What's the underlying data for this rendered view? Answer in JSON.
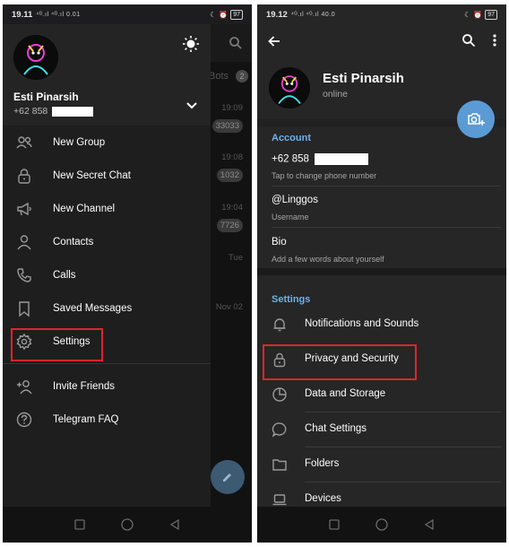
{
  "colors": {
    "accent": "#6fb0ea",
    "fab": "#5b9bd5",
    "highlight": "#e0242d",
    "drawer_bg": "#1e1e1e"
  },
  "left_phone": {
    "status": {
      "time": "19.11",
      "signals": "⁴ᴳ.ıl ⁴ᴳ.ıl 0.01",
      "battery": "97"
    },
    "drawer": {
      "name": "Esti Pinarsih",
      "phone": "+62 858",
      "items": [
        {
          "label": "New Group",
          "icon": "group-icon"
        },
        {
          "label": "New Secret Chat",
          "icon": "lock-icon"
        },
        {
          "label": "New Channel",
          "icon": "megaphone-icon"
        },
        {
          "label": "Contacts",
          "icon": "person-icon"
        },
        {
          "label": "Calls",
          "icon": "phone-icon"
        },
        {
          "label": "Saved Messages",
          "icon": "bookmark-icon"
        },
        {
          "label": "Settings",
          "icon": "gear-icon"
        },
        {
          "label": "Invite Friends",
          "icon": "add-person-icon"
        },
        {
          "label": "Telegram FAQ",
          "icon": "question-icon"
        }
      ]
    },
    "behind": {
      "bots": "Bots",
      "bots_badge": "2",
      "times": [
        "19:09",
        "19:08",
        "19:04",
        "Tue",
        "Nov 02"
      ],
      "counts": [
        "33033",
        "1032",
        "7726"
      ]
    }
  },
  "right_phone": {
    "status": {
      "time": "19.12",
      "signals": "⁴ᴳ.ıl ⁴ᴳ.ıl 40.0",
      "battery": "97"
    },
    "profile": {
      "name": "Esti Pinarsih",
      "status": "online"
    },
    "account": {
      "title": "Account",
      "phone": "+62 858",
      "phone_hint": "Tap to change phone number",
      "username": "@Linggos",
      "username_hint": "Username",
      "bio": "Bio",
      "bio_hint": "Add a few words about yourself"
    },
    "settings": {
      "title": "Settings",
      "items": [
        {
          "label": "Notifications and Sounds",
          "icon": "bell-icon"
        },
        {
          "label": "Privacy and Security",
          "icon": "lock-icon"
        },
        {
          "label": "Data and Storage",
          "icon": "clock-pie-icon"
        },
        {
          "label": "Chat Settings",
          "icon": "chat-bubble-icon"
        },
        {
          "label": "Folders",
          "icon": "folder-icon"
        },
        {
          "label": "Devices",
          "icon": "laptop-icon"
        }
      ]
    }
  }
}
